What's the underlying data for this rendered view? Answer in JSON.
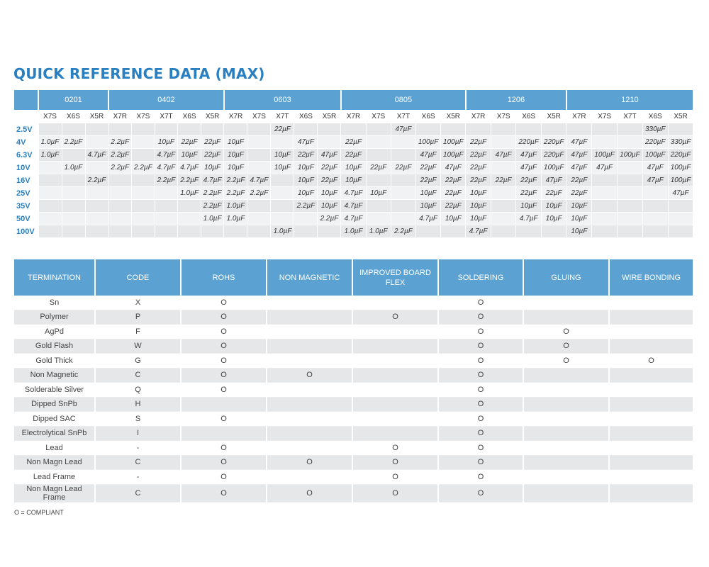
{
  "title": "QUICK REFERENCE DATA (MAX)",
  "footnote": "O = COMPLIANT",
  "capacitor_table": {
    "sizes": [
      {
        "label": "0201",
        "span": 3
      },
      {
        "label": "0402",
        "span": 5
      },
      {
        "label": "0603",
        "span": 5
      },
      {
        "label": "0805",
        "span": 5
      },
      {
        "label": "1206",
        "span": 4
      },
      {
        "label": "1210",
        "span": 5
      }
    ],
    "dielectrics": [
      "X7S",
      "X6S",
      "X5R",
      "X7R",
      "X7S",
      "X7T",
      "X6S",
      "X5R",
      "X7R",
      "X7S",
      "X7T",
      "X6S",
      "X5R",
      "X7R",
      "X7S",
      "X7T",
      "X6S",
      "X5R",
      "X7R",
      "X7S",
      "X6S",
      "X5R",
      "X7R",
      "X7S",
      "X7T",
      "X6S",
      "X5R"
    ],
    "rows": [
      {
        "voltage": "2.5V",
        "cells": [
          "",
          "",
          "",
          "",
          "",
          "",
          "",
          "",
          "",
          "",
          "22µF",
          "",
          "",
          "",
          "",
          "47µF",
          "",
          "",
          "",
          "",
          "",
          "",
          "",
          "",
          "",
          "330µF",
          ""
        ]
      },
      {
        "voltage": "4V",
        "cells": [
          "1.0µF",
          "2.2µF",
          "",
          "2.2µF",
          "",
          "10µF",
          "22µF",
          "22µF",
          "10µF",
          "",
          "",
          "47µF",
          "",
          "22µF",
          "",
          "",
          "100µF",
          "100µF",
          "22µF",
          "",
          "220µF",
          "220µF",
          "47µF",
          "",
          "",
          "220µF",
          "330µF"
        ]
      },
      {
        "voltage": "6.3V",
        "cells": [
          "1.0µF",
          "",
          "4.7µF",
          "2.2µF",
          "",
          "4.7µF",
          "10µF",
          "22µF",
          "10µF",
          "",
          "10µF",
          "22µF",
          "47µF",
          "22µF",
          "",
          "",
          "47µF",
          "100µF",
          "22µF",
          "47µF",
          "47µF",
          "220µF",
          "47µF",
          "100µF",
          "100µF",
          "100µF",
          "220µF"
        ]
      },
      {
        "voltage": "10V",
        "cells": [
          "",
          "1.0µF",
          "",
          "2.2µF",
          "2.2µF",
          "4.7µF",
          "4.7µF",
          "10µF",
          "10µF",
          "",
          "10µF",
          "10µF",
          "22µF",
          "10µF",
          "22µF",
          "22µF",
          "22µF",
          "47µF",
          "22µF",
          "",
          "47µF",
          "100µF",
          "47µF",
          "47µF",
          "",
          "47µF",
          "100µF"
        ]
      },
      {
        "voltage": "16V",
        "cells": [
          "",
          "",
          "2.2µF",
          "",
          "",
          "2.2µF",
          "2.2µF",
          "4.7µF",
          "2.2µF",
          "4.7µF",
          "",
          "10µF",
          "22µF",
          "10µF",
          "",
          "",
          "22µF",
          "22µF",
          "22µF",
          "22µF",
          "22µF",
          "47µF",
          "22µF",
          "",
          "",
          "47µF",
          "100µF"
        ]
      },
      {
        "voltage": "25V",
        "cells": [
          "",
          "",
          "",
          "",
          "",
          "",
          "1.0µF",
          "2.2µF",
          "2.2µF",
          "2.2µF",
          "",
          "10µF",
          "10µF",
          "4.7µF",
          "10µF",
          "",
          "10µF",
          "22µF",
          "10µF",
          "",
          "22µF",
          "22µF",
          "22µF",
          "",
          "",
          "",
          "47µF"
        ]
      },
      {
        "voltage": "35V",
        "cells": [
          "",
          "",
          "",
          "",
          "",
          "",
          "",
          "2.2µF",
          "1.0µF",
          "",
          "",
          "2.2µF",
          "10µF",
          "4.7µF",
          "",
          "",
          "10µF",
          "22µF",
          "10µF",
          "",
          "10µF",
          "10µF",
          "10µF",
          "",
          "",
          "",
          ""
        ]
      },
      {
        "voltage": "50V",
        "cells": [
          "",
          "",
          "",
          "",
          "",
          "",
          "",
          "1.0µF",
          "1.0µF",
          "",
          "",
          "",
          "2.2µF",
          "4.7µF",
          "",
          "",
          "4.7µF",
          "10µF",
          "10µF",
          "",
          "4.7µF",
          "10µF",
          "10µF",
          "",
          "",
          "",
          ""
        ]
      },
      {
        "voltage": "100V",
        "cells": [
          "",
          "",
          "",
          "",
          "",
          "",
          "",
          "",
          "",
          "",
          "1.0µF",
          "",
          "",
          "1.0µF",
          "1.0µF",
          "2.2µF",
          "",
          "",
          "4.7µF",
          "",
          "",
          "",
          "10µF",
          "",
          "",
          "",
          ""
        ]
      }
    ]
  },
  "termination_table": {
    "headers": [
      "TERMINATION",
      "CODE",
      "ROHS",
      "NON MAGNETIC",
      "IMPROVED BOARD FLEX",
      "SOLDERING",
      "GLUING",
      "WIRE BONDING"
    ],
    "rows": [
      [
        "Sn",
        "X",
        "O",
        "",
        "",
        "O",
        "",
        ""
      ],
      [
        "Polymer",
        "P",
        "O",
        "",
        "O",
        "O",
        "",
        ""
      ],
      [
        "AgPd",
        "F",
        "O",
        "",
        "",
        "O",
        "O",
        ""
      ],
      [
        "Gold Flash",
        "W",
        "O",
        "",
        "",
        "O",
        "O",
        ""
      ],
      [
        "Gold Thick",
        "G",
        "O",
        "",
        "",
        "O",
        "O",
        "O"
      ],
      [
        "Non Magnetic",
        "C",
        "O",
        "O",
        "",
        "O",
        "",
        ""
      ],
      [
        "Solderable Silver",
        "Q",
        "O",
        "",
        "",
        "O",
        "",
        ""
      ],
      [
        "Dipped SnPb",
        "H",
        "",
        "",
        "",
        "O",
        "",
        ""
      ],
      [
        "Dipped SAC",
        "S",
        "O",
        "",
        "",
        "O",
        "",
        ""
      ],
      [
        "Electrolytical SnPb",
        "I",
        "",
        "",
        "",
        "O",
        "",
        ""
      ],
      [
        "Lead",
        "-",
        "O",
        "",
        "O",
        "O",
        "",
        ""
      ],
      [
        "Non Magn Lead",
        "C",
        "O",
        "O",
        "O",
        "O",
        "",
        ""
      ],
      [
        "Lead Frame",
        "-",
        "O",
        "",
        "O",
        "O",
        "",
        ""
      ],
      [
        "Non Magn Lead Frame",
        "C",
        "O",
        "O",
        "O",
        "O",
        "",
        ""
      ]
    ]
  }
}
